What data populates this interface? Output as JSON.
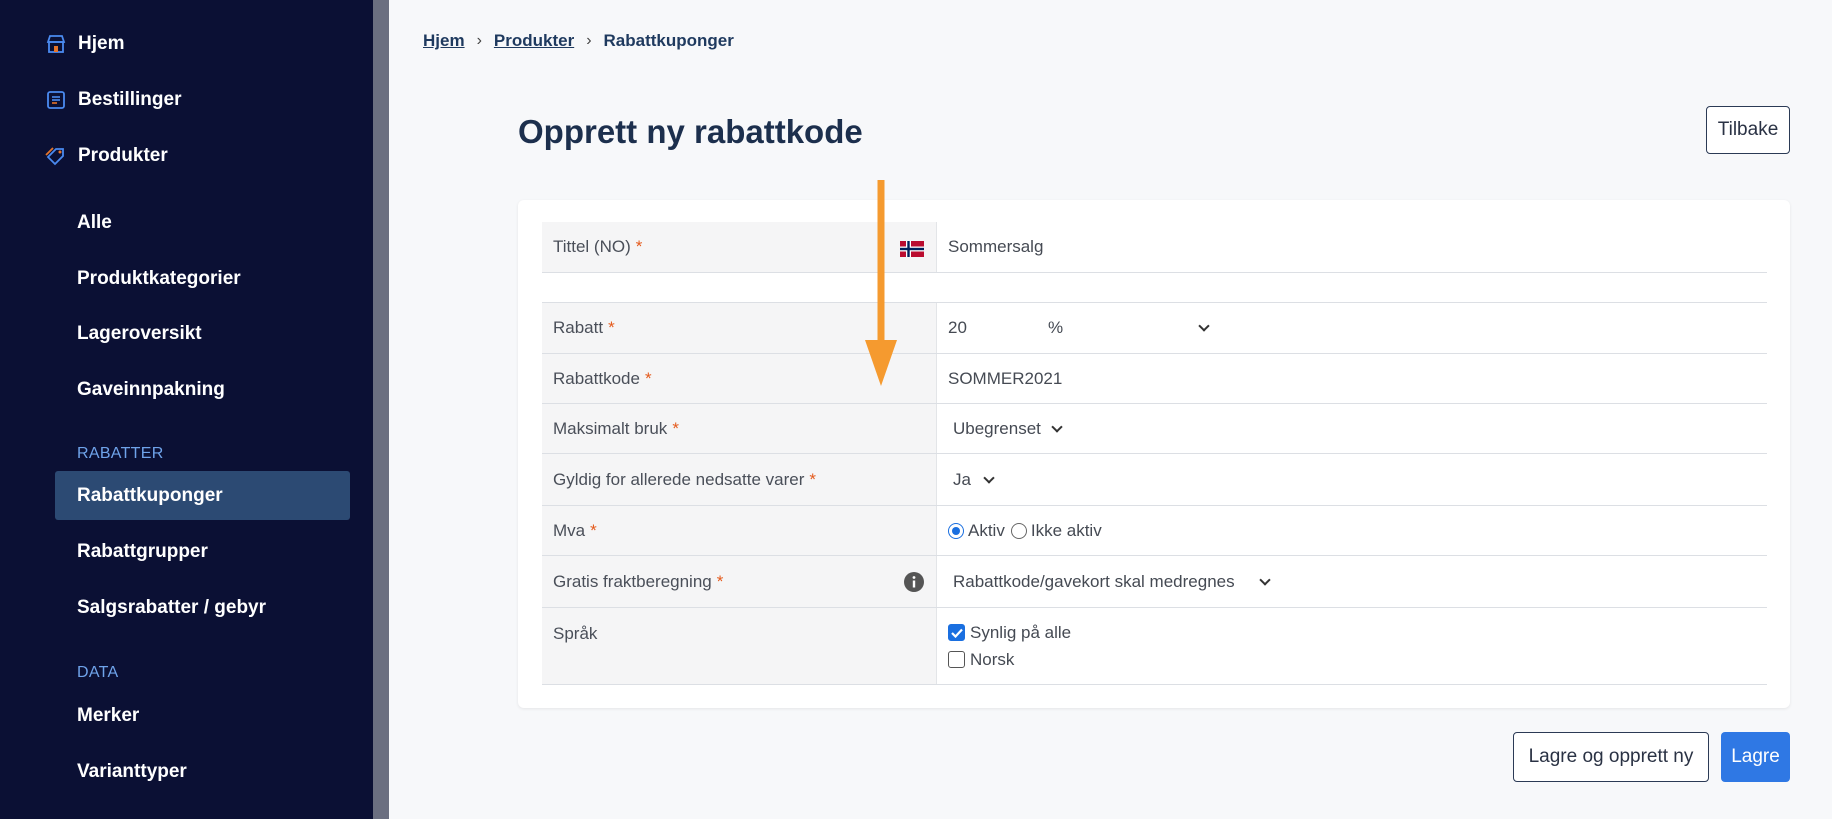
{
  "sidebar": {
    "main_items": [
      {
        "label": "Hjem",
        "icon": "store-icon"
      },
      {
        "label": "Bestillinger",
        "icon": "order-list-icon"
      },
      {
        "label": "Produkter",
        "icon": "tag-icon"
      }
    ],
    "product_items": [
      "Alle",
      "Produktkategorier",
      "Lageroversikt",
      "Gaveinnpakning"
    ],
    "section_discounts": "RABATTER",
    "discount_items": [
      "Rabattkuponger",
      "Rabattgrupper",
      "Salgsrabatter / gebyr"
    ],
    "section_data": "DATA",
    "data_items": [
      "Merker",
      "Varianttyper"
    ]
  },
  "breadcrumb": [
    "Hjem",
    "Produkter",
    "Rabattkuponger"
  ],
  "page_title": "Opprett ny rabattkode",
  "back_label": "Tilbake",
  "form": {
    "title_label": "Tittel (NO)",
    "title_value": "Sommersalg",
    "discount_label": "Rabatt",
    "discount_value": "20",
    "discount_unit": "%",
    "code_label": "Rabattkode",
    "code_value": "SOMMER2021",
    "max_use_label": "Maksimalt bruk",
    "max_use_value": "Ubegrenset",
    "valid_reduced_label": "Gyldig for allerede nedsatte varer",
    "valid_reduced_value": "Ja",
    "vat_label": "Mva",
    "vat_option_active": "Aktiv",
    "vat_option_inactive": "Ikke aktiv",
    "shipping_label": "Gratis fraktberegning",
    "shipping_value": "Rabattkode/gavekort skal medregnes",
    "language_label": "Språk",
    "language_all": "Synlig på alle",
    "language_norwegian": "Norsk",
    "required_mark": "*"
  },
  "actions": {
    "save_and_new": "Lagre og opprett ny",
    "save": "Lagre"
  },
  "colors": {
    "sidebar_bg": "#0b1034",
    "active_item_bg": "#2c4a73",
    "accent_blue": "#2f78e4",
    "required_red": "#e45a1c",
    "annotation_arrow": "#f59a2f"
  }
}
